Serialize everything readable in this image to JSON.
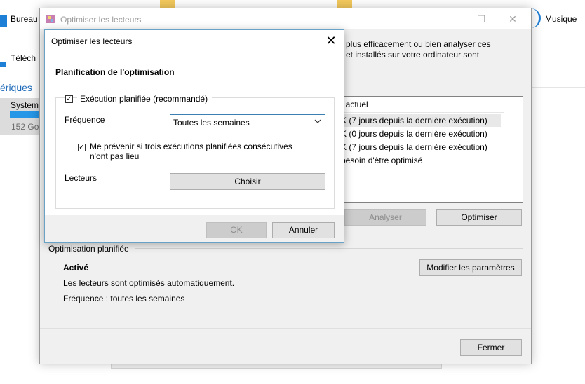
{
  "background": {
    "left_items": [
      "Bureau",
      "Téléchargements"
    ],
    "left_items_visible": [
      "Bureau",
      "Téléch"
    ],
    "section": "Périphériques",
    "section_visible": "ériques",
    "drive_name": "Système",
    "drive_name_visible": "Systeme",
    "drive_free": "152 Go",
    "right_item": "Musique"
  },
  "window": {
    "title": "Optimiser les lecteurs",
    "controls": {
      "minimize": "—",
      "maximize": "☐",
      "close": "✕"
    },
    "description_lines": [
      "plus efficacement ou bien analyser ces",
      "et installés sur votre ordinateur sont"
    ],
    "list": {
      "column_header": "t actuel",
      "rows": [
        "K (7 jours depuis la dernière exécution)",
        "K (0 jours depuis la dernière exécution)",
        "K (7 jours depuis la dernière exécution)",
        "besoin d'être optimisé"
      ]
    },
    "analyze_label": "Analyser",
    "optimize_label": "Optimiser",
    "scheduled": {
      "title": "Optimisation planifiée",
      "status": "Activé",
      "line1": "Les lecteurs sont optimisés automatiquement.",
      "line2": "Fréquence : toutes les semaines",
      "modify_label": "Modifier les paramètres"
    },
    "close_label": "Fermer"
  },
  "dialog": {
    "title": "Optimiser les lecteurs",
    "close_glyph": "✕",
    "heading": "Planification de l'optimisation",
    "scheduled_run_label": "Exécution planifiée (recommandé)",
    "scheduled_run_checked": true,
    "frequency_label": "Fréquence",
    "frequency_value": "Toutes les semaines",
    "notify_line1": "Me prévenir si trois exécutions planifiées consécutives",
    "notify_line2": "n'ont pas lieu",
    "notify_checked": true,
    "drives_label": "Lecteurs",
    "choose_label": "Choisir",
    "ok_label": "OK",
    "cancel_label": "Annuler"
  },
  "colors": {
    "accent": "#1e6bb8",
    "dialog_border": "#6aa2c6",
    "combo_border": "#3c7fb1",
    "drive_bar": "#2696e6"
  }
}
